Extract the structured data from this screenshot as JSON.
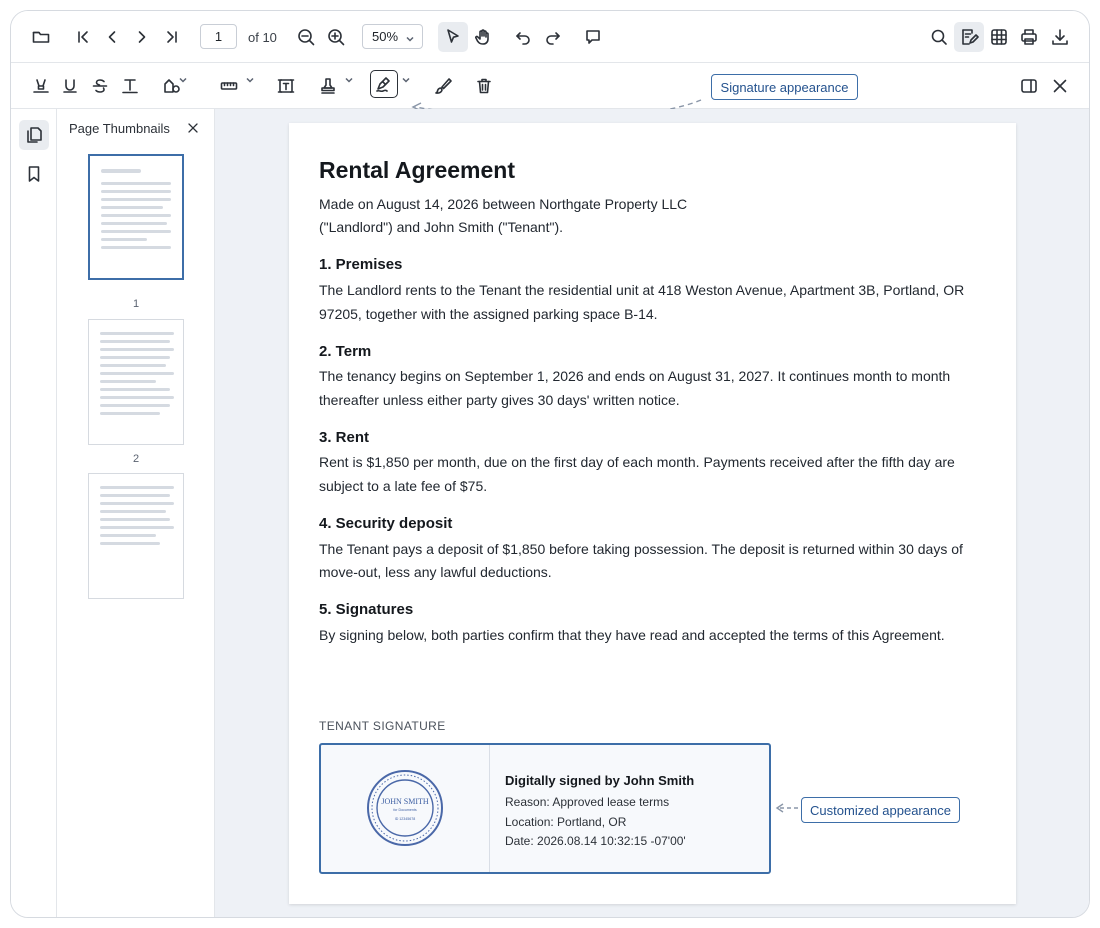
{
  "toolbar": {
    "page_current": "1",
    "page_total": "of 10",
    "zoom": "50%"
  },
  "callouts": {
    "signature_appearance": "Signature appearance",
    "customized_appearance": "Customized appearance"
  },
  "sidebar": {
    "title": "Page Thumbnails",
    "thumb_labels": [
      "1",
      "2"
    ]
  },
  "document": {
    "title": "Rental Agreement",
    "intro_1": "Made on August 14, 2026 between Northgate Property LLC",
    "intro_2": "(\"Landlord\") and John Smith (\"Tenant\").",
    "sections": [
      {
        "heading": "1. Premises",
        "line1": "The Landlord rents to the Tenant the residential unit at 418 Weston Avenue, Apartment 3B, Portland, OR",
        "line2": "97205, together with the assigned parking space B-14."
      },
      {
        "heading": "2. Term",
        "line1": "The tenancy begins on September 1, 2026 and ends on August 31, 2027. It continues month to month",
        "line2": "thereafter unless either party gives 30 days' written notice."
      },
      {
        "heading": "3. Rent",
        "line1": "Rent is $1,850 per month, due on the first day of each month. Payments received after the fifth day are",
        "line2": "subject to a late fee of $75."
      },
      {
        "heading": "4. Security deposit",
        "line1": "The Tenant pays a deposit of $1,850 before taking possession. The deposit is returned within 30 days of",
        "line2": "move-out, less any lawful deductions."
      },
      {
        "heading": "5. Signatures",
        "line1": "By signing below, both parties confirm that they have read and accepted the terms of this Agreement.",
        "line2": ""
      }
    ],
    "signature": {
      "label": "TENANT SIGNATURE",
      "signed_by": "Digitally signed by John Smith",
      "reason": "Reason: Approved lease terms",
      "location": "Location: Portland, OR",
      "date": "Date: 2026.08.14 10:32:15 -07'00'",
      "seal_name": "JOHN SMITH",
      "seal_sub": "for Documents",
      "seal_id": "ID 12345678"
    }
  },
  "colors": {
    "accent": "#3d6ea8",
    "canvas": "#eef1f6"
  }
}
